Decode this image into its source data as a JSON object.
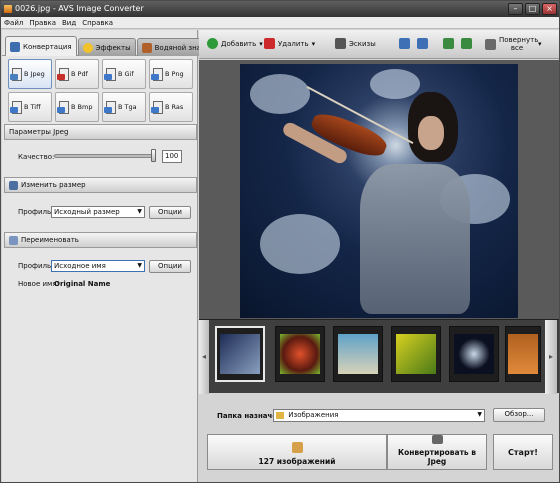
{
  "window": {
    "title": "0026.jpg - AVS Image Converter"
  },
  "menu": [
    "Файл",
    "Правка",
    "Вид",
    "Справка"
  ],
  "tabs": [
    {
      "label": "Конвертация",
      "icon": "convert-icon",
      "active": true
    },
    {
      "label": "Эффекты",
      "icon": "star-icon",
      "active": false
    },
    {
      "label": "Водяной знак",
      "icon": "watermark-icon",
      "active": false
    }
  ],
  "formats": [
    {
      "label": "В Jpeg",
      "color": "#4a7fbd",
      "selected": true
    },
    {
      "label": "В Pdf",
      "color": "#c8302a",
      "selected": false
    },
    {
      "label": "В Gif",
      "color": "#3f78c8",
      "selected": false
    },
    {
      "label": "В Png",
      "color": "#3f78c8",
      "selected": false
    },
    {
      "label": "В Tiff",
      "color": "#3f78c8",
      "selected": false
    },
    {
      "label": "В Bmp",
      "color": "#3f78c8",
      "selected": false
    },
    {
      "label": "В Tga",
      "color": "#3f78c8",
      "selected": false
    },
    {
      "label": "В Ras",
      "color": "#3f78c8",
      "selected": false
    }
  ],
  "params": {
    "title": "Параметры Jpeg",
    "quality_label": "Качество:",
    "quality_value": "100"
  },
  "resize": {
    "title": "Изменить размер",
    "profile_label": "Профиль:",
    "profile_value": "Исходный размер",
    "options_label": "Опции"
  },
  "rename": {
    "title": "Переименовать",
    "profile_label": "Профиль:",
    "profile_value": "Исходное имя",
    "options_label": "Опции",
    "newname_label": "Новое имя:",
    "newname_value": "Original Name"
  },
  "toolbar": {
    "add": "Добавить",
    "delete": "Удалить",
    "sketches": "Эскизы",
    "rotate": "Повернуть все"
  },
  "thumbnails": [
    {
      "colors": [
        "#1d2c55",
        "#8aa0c0"
      ],
      "selected": true
    },
    {
      "colors": [
        "#5a1a10",
        "#7ab830"
      ],
      "selected": false
    },
    {
      "colors": [
        "#5fa2c8",
        "#d8d2b8"
      ],
      "selected": false
    },
    {
      "colors": [
        "#d8d020",
        "#4a7a18"
      ],
      "selected": false
    },
    {
      "colors": [
        "#0b1020",
        "#c8d8e8"
      ],
      "selected": false
    },
    {
      "colors": [
        "#b06020",
        "#e08a3a"
      ],
      "selected": false
    }
  ],
  "destination": {
    "label": "Папка назначения:",
    "value": "Изображения",
    "browse": "Обзор..."
  },
  "actions": {
    "count": "127 изображений",
    "convert": "Конвертировать в Jpeg",
    "start": "Старт!"
  }
}
